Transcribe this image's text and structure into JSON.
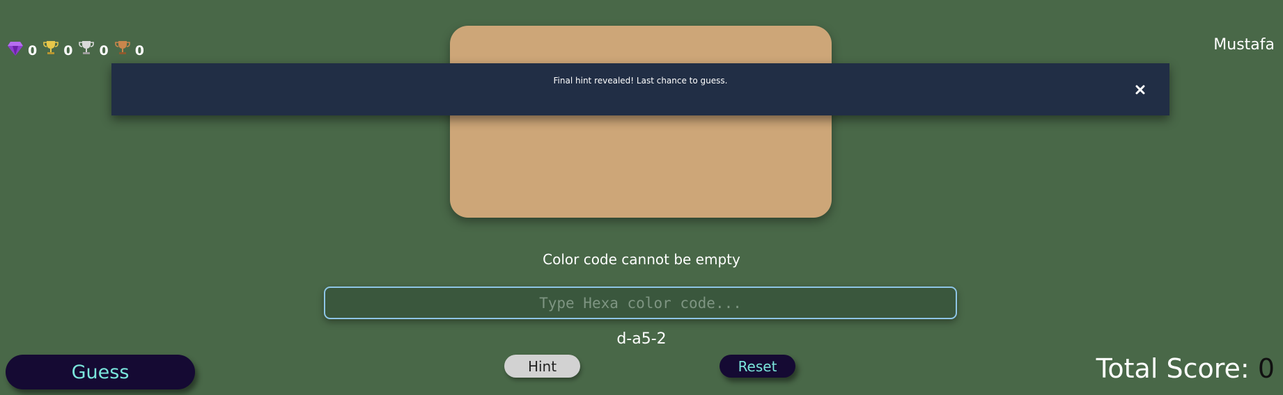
{
  "header": {
    "username": "Mustafa",
    "trophies": [
      {
        "icon": "diamond-icon",
        "count": "0",
        "color": "#8f3fd1"
      },
      {
        "icon": "gold-trophy-icon",
        "count": "0",
        "color": "#e6c64a"
      },
      {
        "icon": "silver-trophy-icon",
        "count": "0",
        "color": "#cfcfcf"
      },
      {
        "icon": "bronze-trophy-icon",
        "count": "0",
        "color": "#c9864c"
      }
    ]
  },
  "card": {
    "color": "#cda678"
  },
  "toast": {
    "message": "Final hint revealed! Last chance to guess.",
    "close_icon": "close-icon"
  },
  "status": {
    "message": "Color code cannot be empty"
  },
  "input": {
    "placeholder": "Type Hexa color code...",
    "value": ""
  },
  "hint": {
    "text": "d-a5-2"
  },
  "buttons": {
    "guess_label": "Guess",
    "hint_label": "Hint",
    "reset_label": "Reset"
  },
  "score": {
    "label": "Total Score:",
    "value": "0"
  },
  "colors": {
    "background": "#496848",
    "accent": "#7ae6dc",
    "dark_button": "#150a33",
    "toast": "#212e45"
  }
}
